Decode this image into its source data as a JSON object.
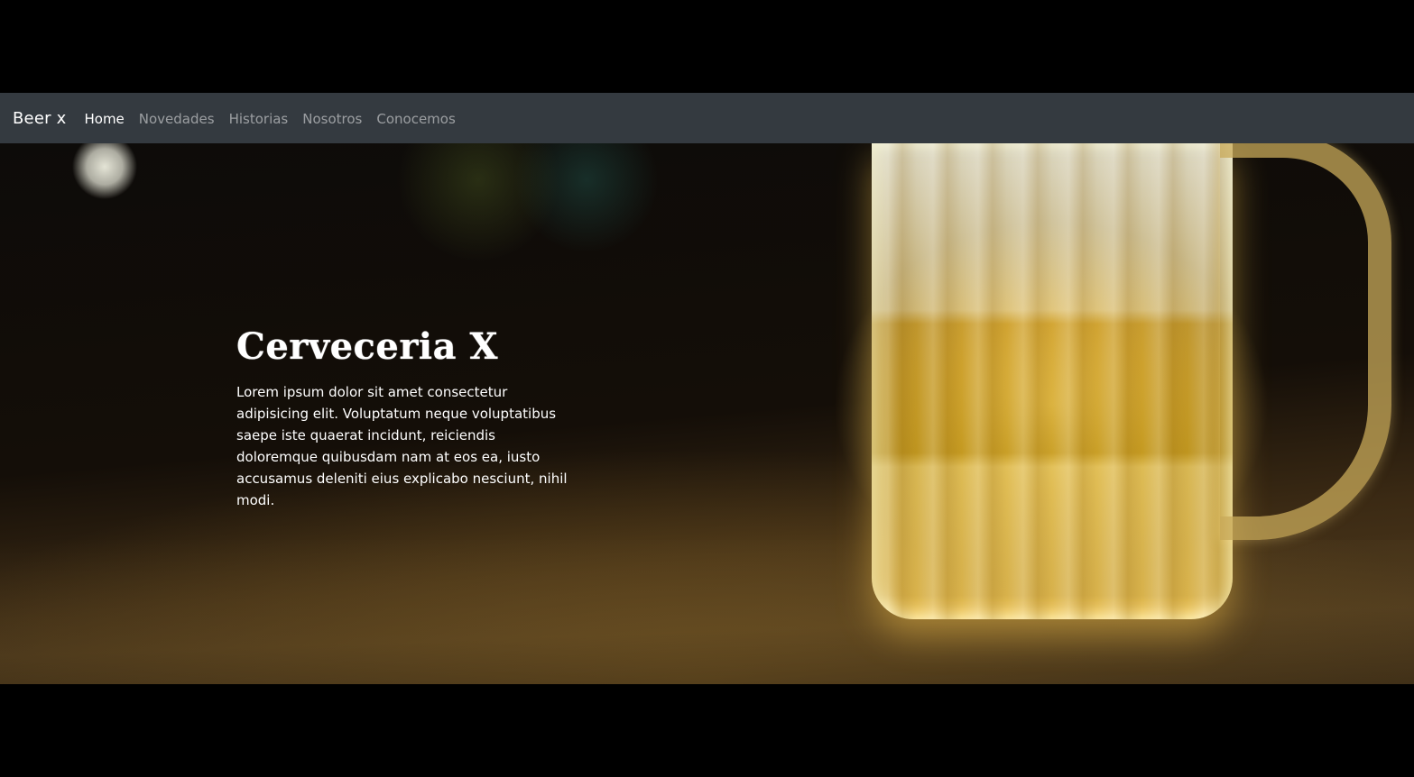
{
  "navbar": {
    "brand": "Beer x",
    "links": [
      {
        "label": "Home",
        "active": true
      },
      {
        "label": "Novedades",
        "active": false
      },
      {
        "label": "Historias",
        "active": false
      },
      {
        "label": "Nosotros",
        "active": false
      },
      {
        "label": "Conocemos",
        "active": false
      }
    ],
    "background_color": "#343a40"
  },
  "hero": {
    "title": "Cerveceria X",
    "body": "Lorem ipsum dolor sit amet consectetur adipisicing elit. Voluptatum neque voluptatibus saepe iste quaerat incidunt, reiciendis doloremque quibusdam nam at eos ea, iusto accusamus deleniti eius explicabo nesciunt, nihil modi.",
    "text_color": "#ffffff"
  }
}
